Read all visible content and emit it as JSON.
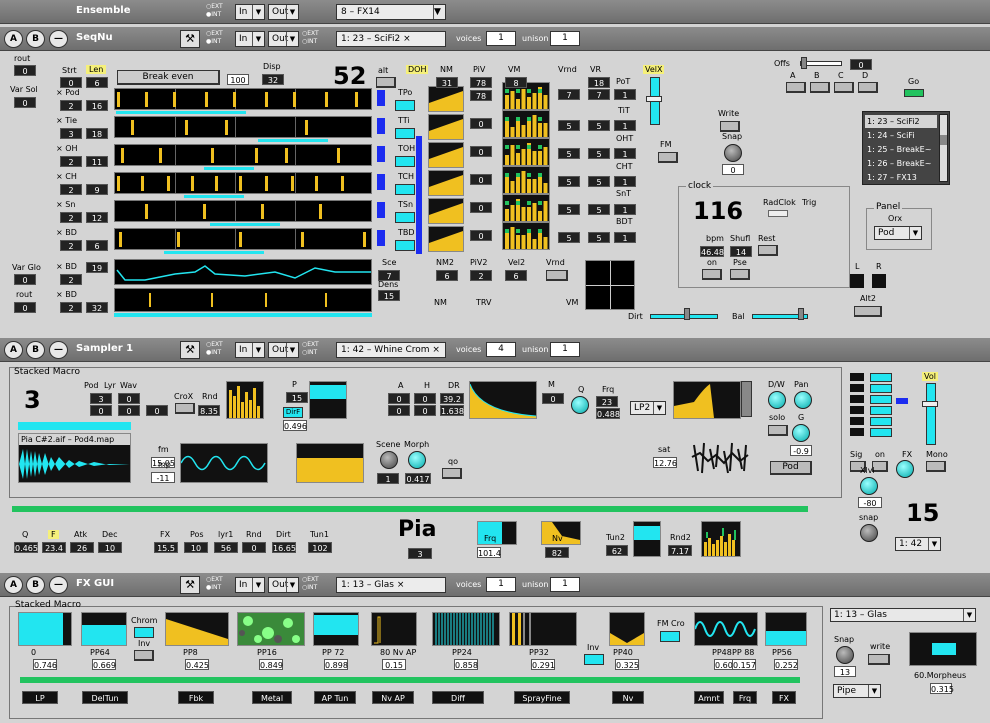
{
  "top_bar": {
    "title": "Ensemble",
    "preset": "8 – FX14",
    "in": "In",
    "out": "Out"
  },
  "extint": {
    "ext": "EXT",
    "int": "INT"
  },
  "seqnu": {
    "header": {
      "name": "SeqNu",
      "in": "In",
      "out": "Out",
      "preset": "1: 23 – SciFi2 ×",
      "voices_label": "voices",
      "voices": "1",
      "unison_label": "unison",
      "unison": "1"
    },
    "rout_label": "rout",
    "rout_val": "0",
    "varsol_label": "Var Sol",
    "varsol_val": "0",
    "strt": "Strt",
    "len": "Len",
    "rows": [
      {
        "label": "× Pod",
        "a": "2",
        "b": "16",
        "top_a": "0",
        "top_b": "6"
      },
      {
        "label": "× Tie",
        "a": "3",
        "b": "18",
        "top_a": "",
        "top_b": ""
      },
      {
        "label": "× OH",
        "a": "2",
        "b": "11",
        "top_a": "",
        "top_b": ""
      },
      {
        "label": "× CH",
        "a": "2",
        "b": "9",
        "top_a": "",
        "top_b": ""
      },
      {
        "label": "× Sn",
        "a": "2",
        "b": "12",
        "top_a": "",
        "top_b": ""
      },
      {
        "label": "× BD",
        "a": "2",
        "b": "6",
        "top_a": "",
        "top_b": ""
      }
    ],
    "varglo_label": "Var Glo",
    "varglo_val": "0",
    "rout2_label": "rout",
    "rout2_val": "0",
    "row7": {
      "label": "× BD",
      "a": "2",
      "b": "19"
    },
    "row8": {
      "label": "× BD",
      "a": "2",
      "b": "32"
    },
    "break_even": "Break even",
    "break_val": "100",
    "disp_label": "Disp",
    "disp_val": "32",
    "big_num": "52",
    "alt": "alt",
    "sub_labels": [
      "TPo",
      "TTi",
      "TOH",
      "TCH",
      "TSn",
      "TBD"
    ],
    "doh": "DOH",
    "nm": "NM",
    "nm_val": "31",
    "piv": "PiV",
    "piv_val": "78",
    "piv_val2": "78",
    "vm": "VM",
    "vm_val": "8",
    "vrnd": "Vrnd",
    "vr": "VR",
    "vr_val": "18",
    "vrnd_a": "7",
    "vrnd_b": "7",
    "vr_b": "1",
    "velx": "VelX",
    "pot": "PoT",
    "tit": "TiT",
    "oht": "OHT",
    "cht": "CHT",
    "snt": "SnT",
    "bdt": "BDT",
    "row_vals": [
      [
        "0",
        "5",
        "5",
        "1"
      ],
      [
        "0",
        "5",
        "5",
        "1"
      ],
      [
        "0",
        "5",
        "5",
        "1"
      ],
      [
        "0",
        "5",
        "5",
        "1"
      ],
      [
        "0",
        "5",
        "5",
        "1"
      ]
    ],
    "sce": "Sce",
    "sce_val": "7",
    "dens": "Dens",
    "dens_val": "15",
    "nm2": "NM2",
    "nm2_val": "6",
    "piv2": "PiV2",
    "piv2_val": "2",
    "vel2": "Vel2",
    "vel2_val": "6",
    "vrnd2": "Vrnd",
    "nm_b": "NM",
    "trv": "TRV",
    "vm_b": "VM",
    "offs": "Offs",
    "offs_val": "0",
    "offs_btns": [
      "A",
      "B",
      "C",
      "D"
    ],
    "go": "Go",
    "write": "Write",
    "snap": "Snap",
    "snap_val": "0",
    "fm": "FM",
    "presets": [
      "1: 23 – SciFi2",
      "1: 24 – SciFi",
      "1: 25 – BreakE~",
      "1: 26 – BreakE~",
      "1: 27 – FX13"
    ],
    "clock_label": "clock",
    "clock_val": "116",
    "radclok": "RadClok",
    "trig": "Trig",
    "bpm": "bpm",
    "bpm_val": "46.48",
    "shufl": "Shufl",
    "shufl_val": "14",
    "rest": "Rest",
    "on": "on",
    "pse": "Pse",
    "panel_label": "Panel",
    "orx": "Orx",
    "pod": "Pod",
    "l": "L",
    "r": "R",
    "alt2": "Alt2",
    "dirt": "Dirt",
    "bal": "Bal"
  },
  "sampler": {
    "header": {
      "name": "Sampler 1",
      "in": "In",
      "out": "Out",
      "preset": "1: 42 – Whine Crom ×",
      "voices_label": "voices",
      "voices": "4",
      "unison_label": "unison",
      "unison": "1"
    },
    "macro_title": "Stacked Macro",
    "big3": "3",
    "pod": "Pod",
    "lyr": "Lyr",
    "wav": "Wav",
    "pod_v": "3",
    "lyr_v": "0",
    "wav_v": "0",
    "lyr_v2": "0",
    "wav_v2": "0",
    "x0": "0",
    "crox": "CroX",
    "rnd": "Rnd",
    "rnd_val": "8.35",
    "p": "P",
    "p_val": "15",
    "dirf": "DirF",
    "p_val2": "0.496",
    "a": "A",
    "h": "H",
    "dr": "DR",
    "a_v": "0",
    "h_v": "0",
    "dr_v": "39.2",
    "a_v2": "0",
    "h_v2": "0",
    "dr_v2": "1.638",
    "m": "M",
    "m_val": "0",
    "q": "Q",
    "frq": "Frq",
    "frq_val": "23",
    "frq_val2": "0.488",
    "lp2": "LP2",
    "dw": "D/W",
    "pan": "Pan",
    "solo": "solo",
    "g": "G",
    "g_val": "-0.9",
    "file": "Pia C#2.aif – Pod4.map",
    "fm": "fm",
    "fm_val": "15.05",
    "mp": "mp",
    "mp_val": "-11",
    "scene": "Scene",
    "morph": "Morph",
    "scene_val": "1",
    "morph_val": "0.417",
    "qo": "qo",
    "sat": "sat",
    "sat_val": "12.76",
    "pod_btn": "Pod",
    "vol": "Vol",
    "sig": "Sig",
    "on": "on",
    "fx": "FX",
    "mono": "Mono",
    "xlvl": "Xlvl",
    "xlvl_val": "-80",
    "snap": "snap",
    "big15": "15",
    "sel15": "1: 42",
    "q_b": "Q",
    "q_b_val": "0.465",
    "f": "F",
    "f_val": "23.4",
    "atk": "Atk",
    "atk_val": "26",
    "dec": "Dec",
    "dec_val": "10",
    "fx_b": "FX",
    "fx_b_val": "15.5",
    "pos": "Pos",
    "pos_val": "10",
    "lyr1": "lyr1",
    "lyr1_val": "56",
    "rnd_b": "Rnd",
    "rnd_b_val": "0",
    "dirt": "Dirt",
    "dirt_val": "16.65",
    "tun1": "Tun1",
    "tun1_val": "102",
    "pia": "Pia",
    "pia_val": "3",
    "frq_b": "Frq",
    "frq_b_val": "101.4",
    "nv": "Nv",
    "nv_val": "82",
    "tun2": "Tun2",
    "tun2_val": "62",
    "rnd2": "Rnd2",
    "rnd2_val": "7.17"
  },
  "fxgui": {
    "header": {
      "name": "FX GUI",
      "in": "In",
      "out": "Out",
      "preset": "1: 13 – Glas ×",
      "voices_label": "voices",
      "voices": "1",
      "unison_label": "unison",
      "unison": "1"
    },
    "macro_title": "Stacked Macro",
    "slots": [
      {
        "name": "0",
        "val": "0.746"
      },
      {
        "name": "PP64",
        "val": "0.669"
      },
      {
        "name": "PP8",
        "val": "0.425"
      },
      {
        "name": "PP16",
        "val": "0.849"
      },
      {
        "name": "PP 72",
        "val": "0.898"
      },
      {
        "name": "80 Nv AP",
        "val": "0.15"
      },
      {
        "name": "PP24",
        "val": "0.858"
      },
      {
        "name": "PP32",
        "val": "0.291"
      },
      {
        "name": "PP40",
        "val": "0.325"
      },
      {
        "name": "PP48",
        "val": "0.606"
      },
      {
        "name": "PP 88",
        "val": "0.157"
      },
      {
        "name": "PP56",
        "val": "0.252"
      }
    ],
    "chrom": "Chrom",
    "inv": "Inv",
    "inv2": "Inv",
    "fmcro": "FM Cro",
    "tabs": [
      "LP",
      "DelTun",
      "Fbk",
      "Metal",
      "AP Tun",
      "Nv AP",
      "Diff",
      "SprayFine",
      "Nv",
      "Amnt",
      "Frq",
      "FX"
    ],
    "preset_sel": "1: 13 – Glas",
    "snap": "Snap",
    "snap_val": "13",
    "write": "write",
    "pipe": "Pipe",
    "morpheus": "60.Morpheus",
    "morpheus_val": "0.315"
  }
}
